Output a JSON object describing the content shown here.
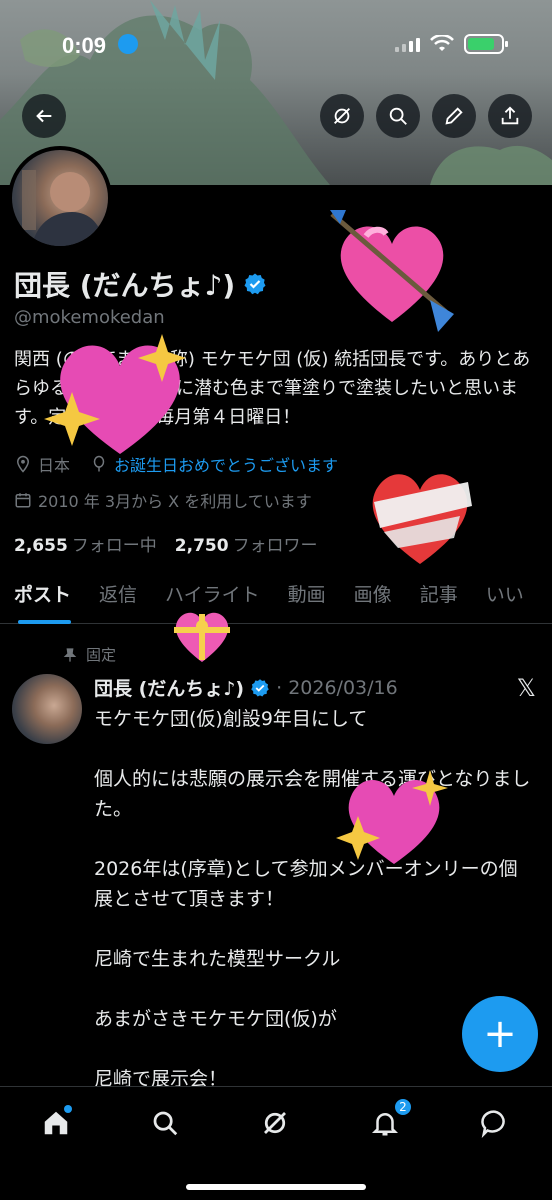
{
  "status": {
    "time": "0:09"
  },
  "profile": {
    "name": "団長 (だんちょ♪)",
    "handle": "@mokemokedan",
    "bio": "関西 (の果てまで自称) モケモケ団 (仮) 統括団長です。ありとあらゆる全ての物の奥に潜む色まで筆塗りで塗装したいと思います。定例製作会は毎月第４日曜日！",
    "location": "日本",
    "birthday": "お誕生日おめでとうございます",
    "joined": "2010 年 3月から X を利用しています",
    "following_count": "2,655",
    "following_label": "フォロー中",
    "followers_count": "2,750",
    "followers_label": "フォロワー"
  },
  "tabs": [
    "ポスト",
    "返信",
    "ハイライト",
    "動画",
    "画像",
    "記事",
    "いい"
  ],
  "post": {
    "pinned_label": "固定",
    "author": "団長 (だんちょ♪)",
    "date": "· 2026/03/16",
    "lines": [
      "モケモケ団(仮)創設9年目にして",
      "個人的には悲願の展示会を開催する運びとなりました。",
      "2026年は(序章)として参加メンバーオンリーの個展とさせて頂きます！",
      "尼崎で生まれた模型サークル",
      "あまがさきモケモケ団(仮)が",
      "尼崎で展示会！"
    ]
  },
  "fab_label": "+",
  "nav": {
    "notification_badge": "2"
  },
  "colors": {
    "accent": "#1d9bf0",
    "bg": "#000000",
    "muted": "#71767b",
    "text": "#e7e9ea"
  }
}
